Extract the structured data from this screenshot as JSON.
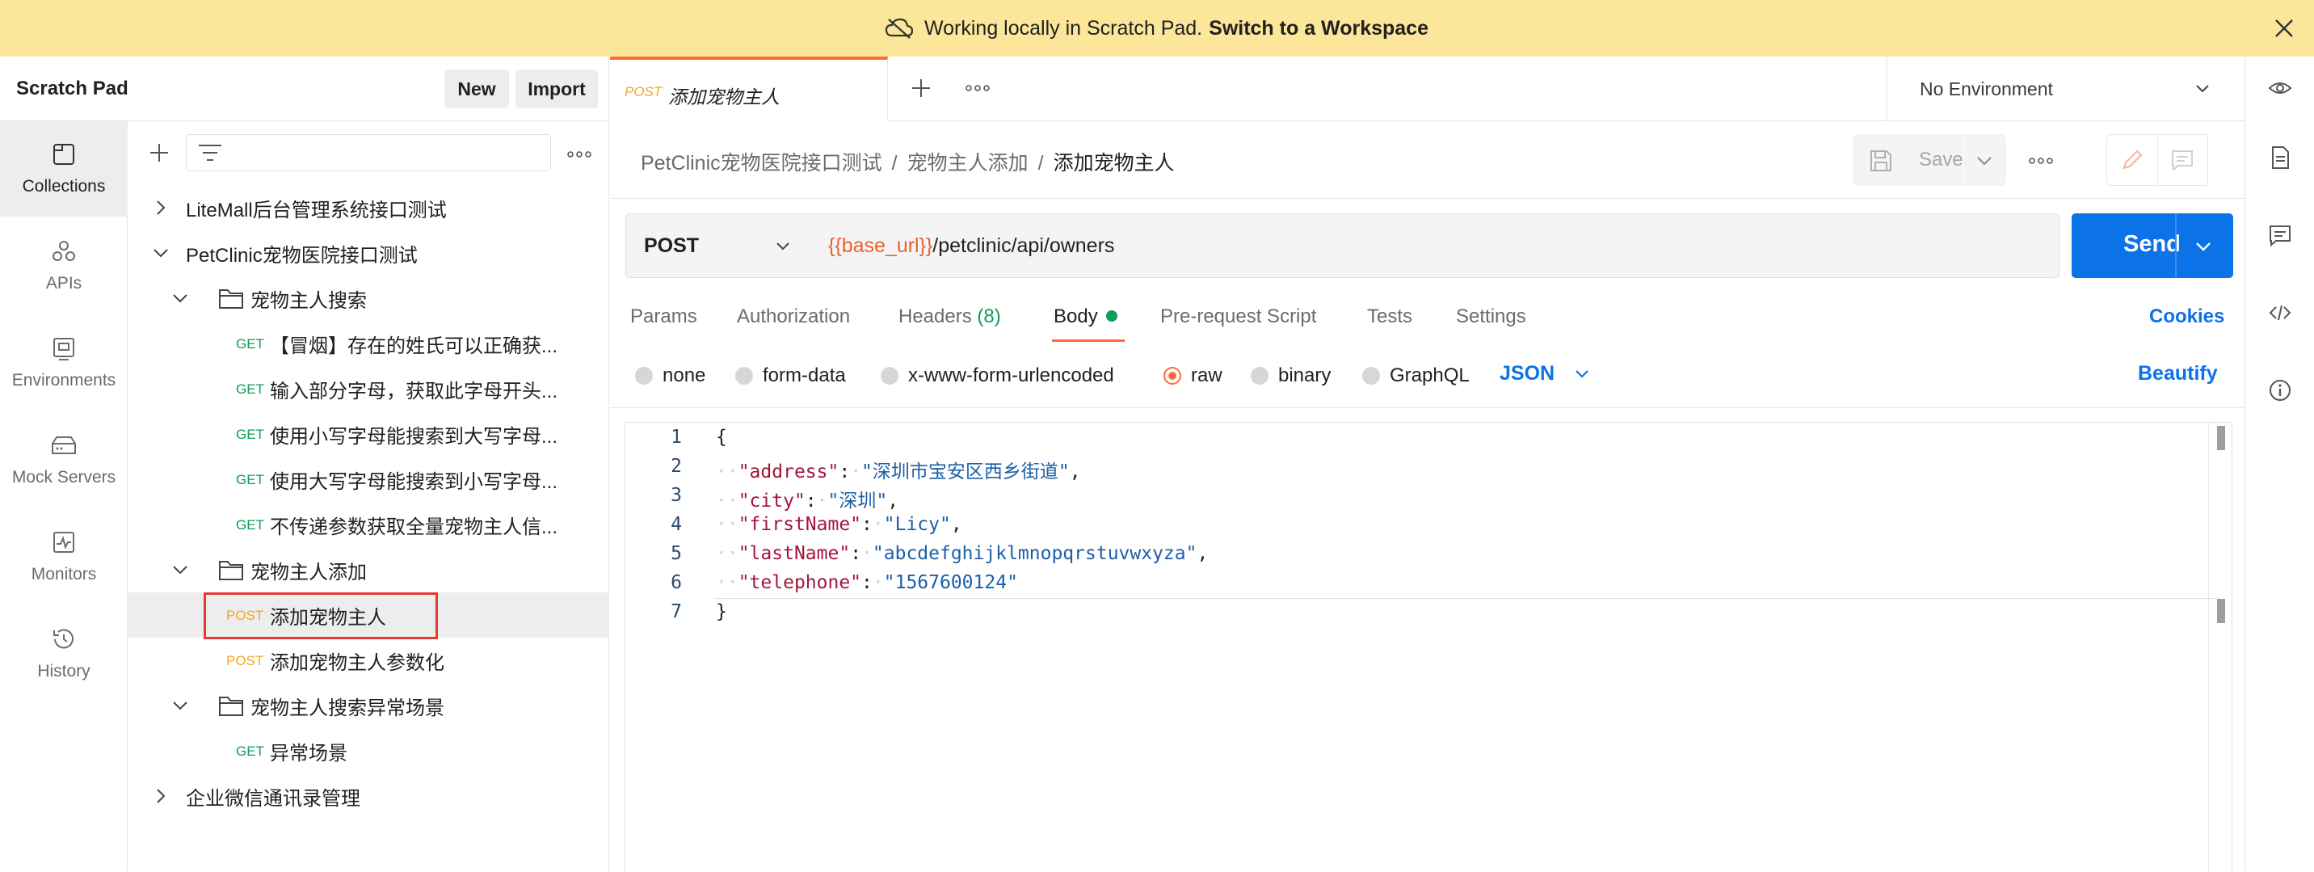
{
  "banner": {
    "text": "Working locally in Scratch Pad.",
    "link": "Switch to a Workspace"
  },
  "sidebar": {
    "title": "Scratch Pad",
    "new_label": "New",
    "import_label": "Import",
    "rail": [
      {
        "label": "Collections",
        "icon": "collections-icon"
      },
      {
        "label": "APIs",
        "icon": "apis-icon"
      },
      {
        "label": "Environments",
        "icon": "environments-icon"
      },
      {
        "label": "Mock Servers",
        "icon": "mock-servers-icon"
      },
      {
        "label": "Monitors",
        "icon": "monitors-icon"
      },
      {
        "label": "History",
        "icon": "history-icon"
      }
    ],
    "tree": [
      {
        "label": "LiteMall后台管理系统接口测试"
      },
      {
        "label": "PetClinic宠物医院接口测试"
      },
      {
        "label": "宠物主人搜索"
      },
      {
        "method": "GET",
        "label": "【冒烟】存在的姓氏可以正确获..."
      },
      {
        "method": "GET",
        "label": "输入部分字母，获取此字母开头..."
      },
      {
        "method": "GET",
        "label": "使用小写字母能搜索到大写字母..."
      },
      {
        "method": "GET",
        "label": "使用大写字母能搜索到小写字母..."
      },
      {
        "method": "GET",
        "label": "不传递参数获取全量宠物主人信..."
      },
      {
        "label": "宠物主人添加"
      },
      {
        "method": "POST",
        "label": "添加宠物主人"
      },
      {
        "method": "POST",
        "label": "添加宠物主人参数化"
      },
      {
        "label": "宠物主人搜索异常场景"
      },
      {
        "method": "GET",
        "label": "异常场景"
      },
      {
        "label": "企业微信通讯录管理"
      }
    ]
  },
  "tab": {
    "method": "POST",
    "name": "添加宠物主人"
  },
  "environment": {
    "selected": "No Environment"
  },
  "breadcrumb": {
    "part1": "PetClinic宠物医院接口测试",
    "part2": "宠物主人添加",
    "current": "添加宠物主人",
    "sep": "/"
  },
  "toolbar": {
    "save_label": "Save"
  },
  "request": {
    "method": "POST",
    "url_var": "{{base_url}}",
    "url_path": "/petclinic/api/owners",
    "send_label": "Send"
  },
  "req_tabs": {
    "params": "Params",
    "authorization": "Authorization",
    "headers": "Headers",
    "headers_count": "(8)",
    "body": "Body",
    "prerequest": "Pre-request Script",
    "tests": "Tests",
    "settings": "Settings",
    "cookies": "Cookies"
  },
  "body_types": {
    "none": "none",
    "form_data": "form-data",
    "urlencoded": "x-www-form-urlencoded",
    "raw": "raw",
    "binary": "binary",
    "graphql": "GraphQL",
    "format": "JSON",
    "beautify": "Beautify"
  },
  "editor": {
    "line_numbers": [
      "1",
      "2",
      "3",
      "4",
      "5",
      "6",
      "7"
    ],
    "open_brace": "{",
    "close_brace": "}",
    "fields": [
      {
        "key": "\"address\"",
        "value": "\"深圳市宝安区西乡街道\"",
        "comma": ","
      },
      {
        "key": "\"city\"",
        "value": "\"深圳\"",
        "comma": ","
      },
      {
        "key": "\"firstName\"",
        "value": "\"Licy\"",
        "comma": ","
      },
      {
        "key": "\"lastName\"",
        "value": "\"abcdefghijklmnopqrstuvwxyza\"",
        "comma": ","
      },
      {
        "key": "\"telephone\"",
        "value": "\"1567600124\"",
        "comma": ""
      }
    ]
  },
  "colors": {
    "accent": "#ff6c37",
    "send_blue": "#0c72e8",
    "banner": "#fbe699",
    "get_green": "#0f9d58",
    "post_orange": "#f5a623"
  }
}
